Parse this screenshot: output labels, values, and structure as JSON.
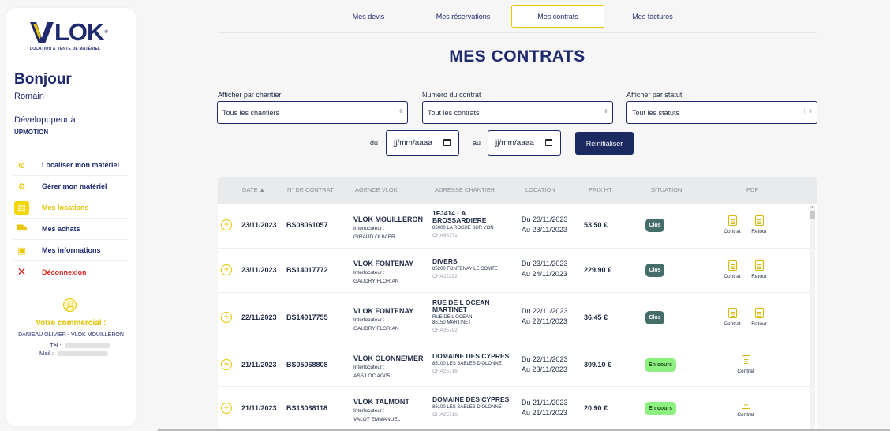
{
  "brand": {
    "name": "LOK",
    "subtitle": "LOCATION & VENTE DE MATÉRIEL"
  },
  "user": {
    "greeting": "Bonjour",
    "name": "Romain",
    "role": "Développpeur à",
    "company": "UPMOTION"
  },
  "menu": [
    {
      "label": "Localiser mon matériel",
      "icon": "map-pin-icon",
      "glyph": "⊙"
    },
    {
      "label": "Gérer mon matériel",
      "icon": "equipment-icon",
      "glyph": "⚙"
    },
    {
      "label": "Mes locations",
      "icon": "document-icon",
      "glyph": "▤"
    },
    {
      "label": "Mes achats",
      "icon": "cart-icon",
      "glyph": "⛟"
    },
    {
      "label": "Mes informations",
      "icon": "id-card-icon",
      "glyph": "▣"
    },
    {
      "label": "Déconnexion",
      "icon": "close-icon",
      "glyph": "✕"
    }
  ],
  "commercial": {
    "title": "Votre commercial :",
    "name": "DANIEAU OLIVIER - VLOK MOUILLERON",
    "tel_label": "Tél :",
    "mail_label": "Mail :"
  },
  "tabs": [
    "Mes devis",
    "Mes réservations",
    "Mes contrats",
    "Mes factures"
  ],
  "page_title": "MES CONTRATS",
  "filters": {
    "chantier_label": "Afficher par chantier",
    "chantier_value": "Tous les chantiers",
    "contrat_label": "Numéro du contrat",
    "contrat_value": "Tout les contrats",
    "statut_label": "Afficher par statut",
    "statut_value": "Tout les statuts",
    "du_label": "du",
    "au_label": "au",
    "date_from": "jj/mm/aaaa",
    "date_to": "jj/mm/aaaa",
    "reset_label": "Réinitialiser"
  },
  "table": {
    "headers": [
      "DATE ▲",
      "N° DE CONTRAT",
      "AGENCE VLOK",
      "ADRESSE CHANTIER",
      "LOCATION",
      "PRIX HT",
      "SITUATION",
      "PDF"
    ],
    "rows": [
      {
        "date": "23/11/2023",
        "num": "BS08061057",
        "agency": "VLOK MOUILLERON",
        "interlocutor_label": "Interlocuteur :",
        "interlocutor": "GIRAUD OLIVIER",
        "addr1": "1FJ414 LA BROSSARDIERE",
        "addr2": "85000 LA ROCHE SUR YON",
        "addr3": "CHA98771",
        "loc_from": "Du 23/11/2023",
        "loc_to": "Au 23/11/2023",
        "price": "53.50 €",
        "status": "Clos",
        "pdf": [
          "Contrat",
          "Retour"
        ]
      },
      {
        "date": "23/11/2023",
        "num": "BS14017772",
        "agency": "VLOK FONTENAY",
        "interlocutor_label": "Interlocuteur :",
        "interlocutor": "GAUDRY FLORIAN",
        "addr1": "DIVERS",
        "addr2": "85200 FONTENAY LE COMTE",
        "addr3": "CHA22292",
        "loc_from": "Du 23/11/2023",
        "loc_to": "Au 24/11/2023",
        "price": "229.90 €",
        "status": "Clos",
        "pdf": [
          "Contrat",
          "Retour"
        ]
      },
      {
        "date": "22/11/2023",
        "num": "BS14017755",
        "agency": "VLOK FONTENAY",
        "interlocutor_label": "Interlocuteur :",
        "interlocutor": "GAUDRY FLORIAN",
        "addr1": "RUE DE L OCEAN MARTINET",
        "addr2": "RUE DE L OCEAN\n85150 MARTINET",
        "addr3": "CHA35782",
        "loc_from": "Du 22/11/2023",
        "loc_to": "Au 22/11/2023",
        "price": "36.45 €",
        "status": "Clos",
        "pdf": [
          "Contrat",
          "Retour"
        ]
      },
      {
        "date": "21/11/2023",
        "num": "BS05068808",
        "agency": "VLOK OLONNE/MER",
        "interlocutor_label": "Interlocuteur :",
        "interlocutor": "ASS LOC AG05",
        "addr1": "DOMAINE DES CYPRES",
        "addr2": "85100 LES SABLES D OLONNE",
        "addr3": "CHA25716",
        "loc_from": "Du 22/11/2023",
        "loc_to": "Au 23/11/2023",
        "price": "309.10 €",
        "status": "En cours",
        "pdf": [
          "Contrat"
        ]
      },
      {
        "date": "21/11/2023",
        "num": "BS13038118",
        "agency": "VLOK TALMONT",
        "interlocutor_label": "Interlocuteur :",
        "interlocutor": "VALOT EMMANUEL",
        "addr1": "DOMAINE DES CYPRES",
        "addr2": "85100 LES SABLES D OLONNE",
        "addr3": "CHA25716",
        "loc_from": "Du 21/11/2023",
        "loc_to": "Au 21/11/2023",
        "price": "20.90 €",
        "status": "En cours",
        "pdf": [
          "Contrat"
        ]
      }
    ]
  },
  "colors": {
    "navy": "#1f2a6e",
    "yellow": "#e8c600",
    "clos": "#456d69",
    "en_cours": "#8ff082",
    "logout": "#d6261f"
  }
}
